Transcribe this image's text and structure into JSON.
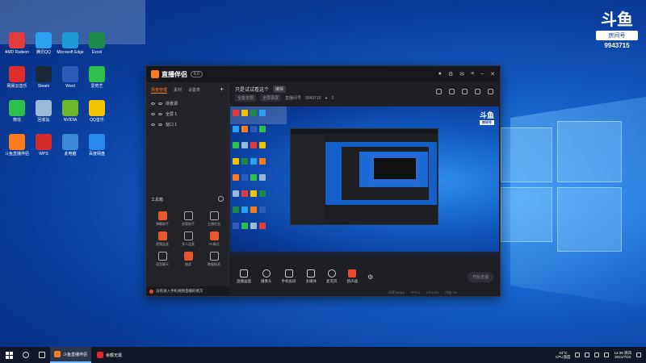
{
  "desktop": {
    "icons": [
      {
        "label": "AMD Radeon",
        "color": "#e23b3b"
      },
      {
        "label": "腾讯QQ",
        "color": "#2aa0f0"
      },
      {
        "label": "Microsoft Edge",
        "color": "#1e9ad6"
      },
      {
        "label": "Excel",
        "color": "#1e8a4a"
      },
      {
        "label": "网易云音乐",
        "color": "#e22b2b"
      },
      {
        "label": "Steam",
        "color": "#1b2838"
      },
      {
        "label": "Word",
        "color": "#2b5cb8"
      },
      {
        "label": "爱奇艺",
        "color": "#2ec04a"
      },
      {
        "label": "微信",
        "color": "#2ec04a"
      },
      {
        "label": "回收站",
        "color": "#9ab8d8"
      },
      {
        "label": "NVIDIA",
        "color": "#6cb82c"
      },
      {
        "label": "QQ音乐",
        "color": "#f5c400"
      },
      {
        "label": "斗鱼直播伴侣",
        "color": "#ff7a1a"
      },
      {
        "label": "WPS",
        "color": "#d22b2b"
      },
      {
        "label": "此电脑",
        "color": "#3a8ad8"
      },
      {
        "label": "百度网盘",
        "color": "#2a8af0"
      }
    ]
  },
  "douyu_logo": {
    "mark": "斗鱼",
    "sub": "房间号",
    "room_number": "9943715"
  },
  "app": {
    "title": "直播伴侣",
    "version": "6.0",
    "tabs": [
      "场景管理",
      "素材",
      "设置表"
    ],
    "scenes": [
      "场景源",
      "全屏 1",
      "窗口 1"
    ],
    "toolbox_label": "工具箱",
    "tools": [
      {
        "label": "弹幕助手",
        "style": "orange"
      },
      {
        "label": "房管助手",
        "style": "outline"
      },
      {
        "label": "主播任务",
        "style": "outline"
      },
      {
        "label": "视频连麦",
        "style": "orange"
      },
      {
        "label": "多人连麦",
        "style": "outline"
      },
      {
        "label": "PK模式",
        "style": "orange"
      },
      {
        "label": "语音聊天",
        "style": "outline"
      },
      {
        "label": "抽奖",
        "style": "orange"
      },
      {
        "label": "数据报表",
        "style": "outline"
      }
    ],
    "tip": "没有进入手机视频直播的地方",
    "stream_title": "只是试试看这个",
    "edit_tag": "编辑",
    "chips": [
      "全能无限",
      "全屏录屏"
    ],
    "room_label": "直播间号",
    "room_number": "9943715",
    "room_count": "0",
    "controls": [
      {
        "label": "直播画面",
        "shape": "square"
      },
      {
        "label": "摄像头",
        "shape": "round"
      },
      {
        "label": "手机投屏",
        "shape": "square"
      },
      {
        "label": "多媒体",
        "shape": "square"
      },
      {
        "label": "麦克风",
        "shape": "round"
      },
      {
        "label": "扬声器",
        "shape": "red"
      }
    ],
    "start_button": "开始直播",
    "status": [
      "码率:0kbps",
      "FPS:0",
      "CPU:6%",
      "内存:7%"
    ]
  },
  "taskbar": {
    "apps": [
      {
        "label": "斗鱼直播伴侣",
        "color": "#ff7a1a",
        "active": true
      },
      {
        "label": "余额无需",
        "color": "#e22b2b",
        "active": false
      }
    ],
    "weather_temp": "44°C",
    "weather_label": "CPU温度",
    "time": "14:39 周四",
    "date": "2021/7/22"
  }
}
